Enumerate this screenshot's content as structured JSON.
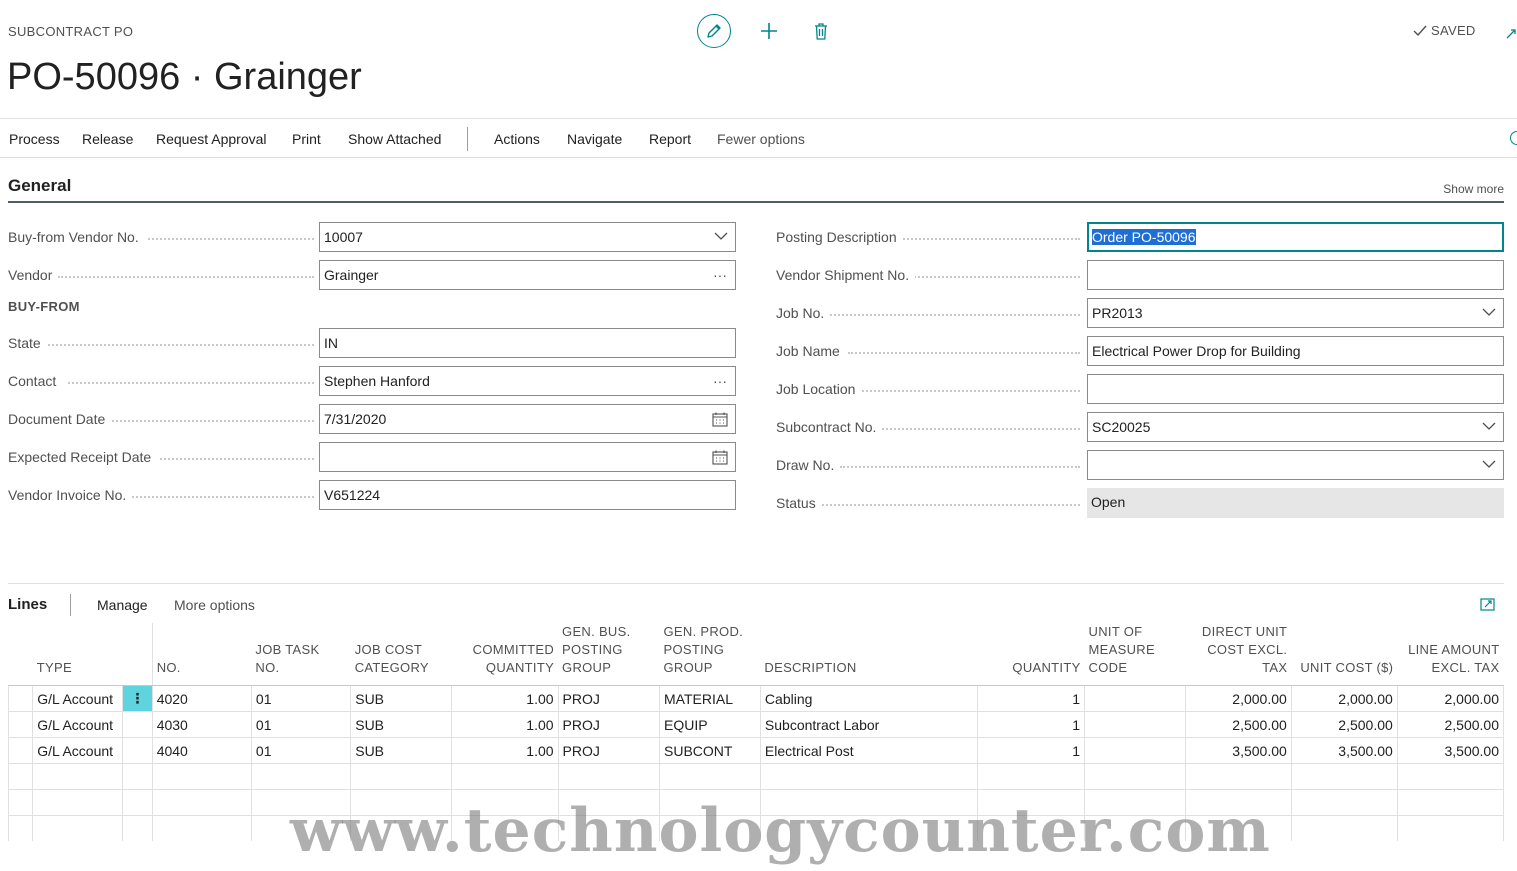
{
  "header": {
    "caption": "SUBCONTRACT PO",
    "title": "PO-50096 · Grainger",
    "saved_label": "SAVED"
  },
  "actions": {
    "process": "Process",
    "release": "Release",
    "request_approval": "Request Approval",
    "print": "Print",
    "show_attached": "Show Attached",
    "actions": "Actions",
    "navigate": "Navigate",
    "report": "Report",
    "fewer_options": "Fewer options"
  },
  "general": {
    "title": "General",
    "show_more": "Show more",
    "buy_from_caption": "BUY-FROM",
    "left": {
      "buy_from_vendor_no": {
        "label": "Buy-from Vendor No.",
        "value": "10007"
      },
      "vendor": {
        "label": "Vendor",
        "value": "Grainger"
      },
      "state": {
        "label": "State",
        "value": "IN"
      },
      "contact": {
        "label": "Contact",
        "value": "Stephen Hanford"
      },
      "document_date": {
        "label": "Document Date",
        "value": "7/31/2020"
      },
      "expected_receipt_date": {
        "label": "Expected Receipt Date",
        "value": ""
      },
      "vendor_invoice_no": {
        "label": "Vendor Invoice No.",
        "value": "V651224"
      }
    },
    "right": {
      "posting_description": {
        "label": "Posting Description",
        "value": "Order PO-50096"
      },
      "vendor_shipment_no": {
        "label": "Vendor Shipment No.",
        "value": ""
      },
      "job_no": {
        "label": "Job No.",
        "value": "PR2013"
      },
      "job_name": {
        "label": "Job Name",
        "value": "Electrical Power Drop for Building"
      },
      "job_location": {
        "label": "Job Location",
        "value": ""
      },
      "subcontract_no": {
        "label": "Subcontract No.",
        "value": "SC20025"
      },
      "draw_no": {
        "label": "Draw No.",
        "value": ""
      },
      "status": {
        "label": "Status",
        "value": "Open"
      }
    }
  },
  "lines": {
    "title": "Lines",
    "manage": "Manage",
    "more_options": "More options",
    "columns": {
      "type": "Type",
      "no": "No.",
      "job_task_no": "Job Task No.",
      "job_cost_category": "Job Cost Category",
      "committed_quantity": "Committed Quantity",
      "gen_bus_posting_group": "Gen. Bus. Posting Group",
      "gen_prod_posting_group": "Gen. Prod. Posting Group",
      "description": "Description",
      "quantity": "Quantity",
      "unit_of_measure_code": "Unit of Measure Code",
      "direct_unit_cost": "Direct Unit Cost Excl. Tax",
      "unit_cost": "Unit Cost ($)",
      "line_amount": "Line Amount Excl. Tax"
    },
    "rows": [
      {
        "type": "G/L Account",
        "no": "4020",
        "job_task_no": "01",
        "job_cost_category": "SUB",
        "committed_quantity": "1.00",
        "gen_bus": "PROJ",
        "gen_prod": "MATERIAL",
        "description": "Cabling",
        "quantity": "1",
        "uom": "",
        "direct_unit_cost": "2,000.00",
        "unit_cost": "2,000.00",
        "line_amount": "2,000.00"
      },
      {
        "type": "G/L Account",
        "no": "4030",
        "job_task_no": "01",
        "job_cost_category": "SUB",
        "committed_quantity": "1.00",
        "gen_bus": "PROJ",
        "gen_prod": "EQUIP",
        "description": "Subcontract Labor",
        "quantity": "1",
        "uom": "",
        "direct_unit_cost": "2,500.00",
        "unit_cost": "2,500.00",
        "line_amount": "2,500.00"
      },
      {
        "type": "G/L Account",
        "no": "4040",
        "job_task_no": "01",
        "job_cost_category": "SUB",
        "committed_quantity": "1.00",
        "gen_bus": "PROJ",
        "gen_prod": "SUBCONT",
        "description": "Electrical Post",
        "quantity": "1",
        "uom": "",
        "direct_unit_cost": "3,500.00",
        "unit_cost": "3,500.00",
        "line_amount": "3,500.00"
      }
    ],
    "row_menu_glyph": "⋮"
  },
  "watermark": "www.technologycounter.com",
  "colors": {
    "accent": "#00848e",
    "selection": "#1f6ed4",
    "row_focus": "#5fd3de"
  }
}
